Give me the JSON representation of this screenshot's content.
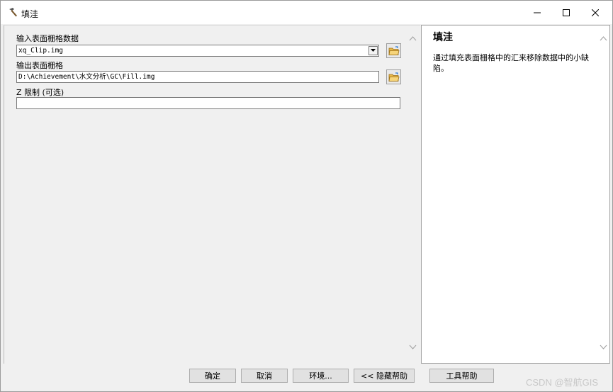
{
  "window": {
    "title": "填洼",
    "icon": "hammer-icon",
    "controls": [
      "minimize-icon",
      "maximize-icon",
      "close-icon"
    ]
  },
  "parameters": {
    "input_raster": {
      "label": "输入表面栅格数据",
      "value": "xq_Clip.img"
    },
    "output_raster": {
      "label": "输出表面栅格",
      "value": "D:\\Achievement\\水文分析\\GC\\Fill.img"
    },
    "z_limit": {
      "label": "Z 限制 (可选)",
      "value": ""
    }
  },
  "help": {
    "title": "填洼",
    "description": "通过填充表面栅格中的汇来移除数据中的小缺陷。"
  },
  "buttons": {
    "ok": "确定",
    "cancel": "取消",
    "environments": "环境...",
    "hide_help": "<< 隐藏帮助",
    "tool_help": "工具帮助"
  },
  "watermark": "CSDN @智航GIS"
}
